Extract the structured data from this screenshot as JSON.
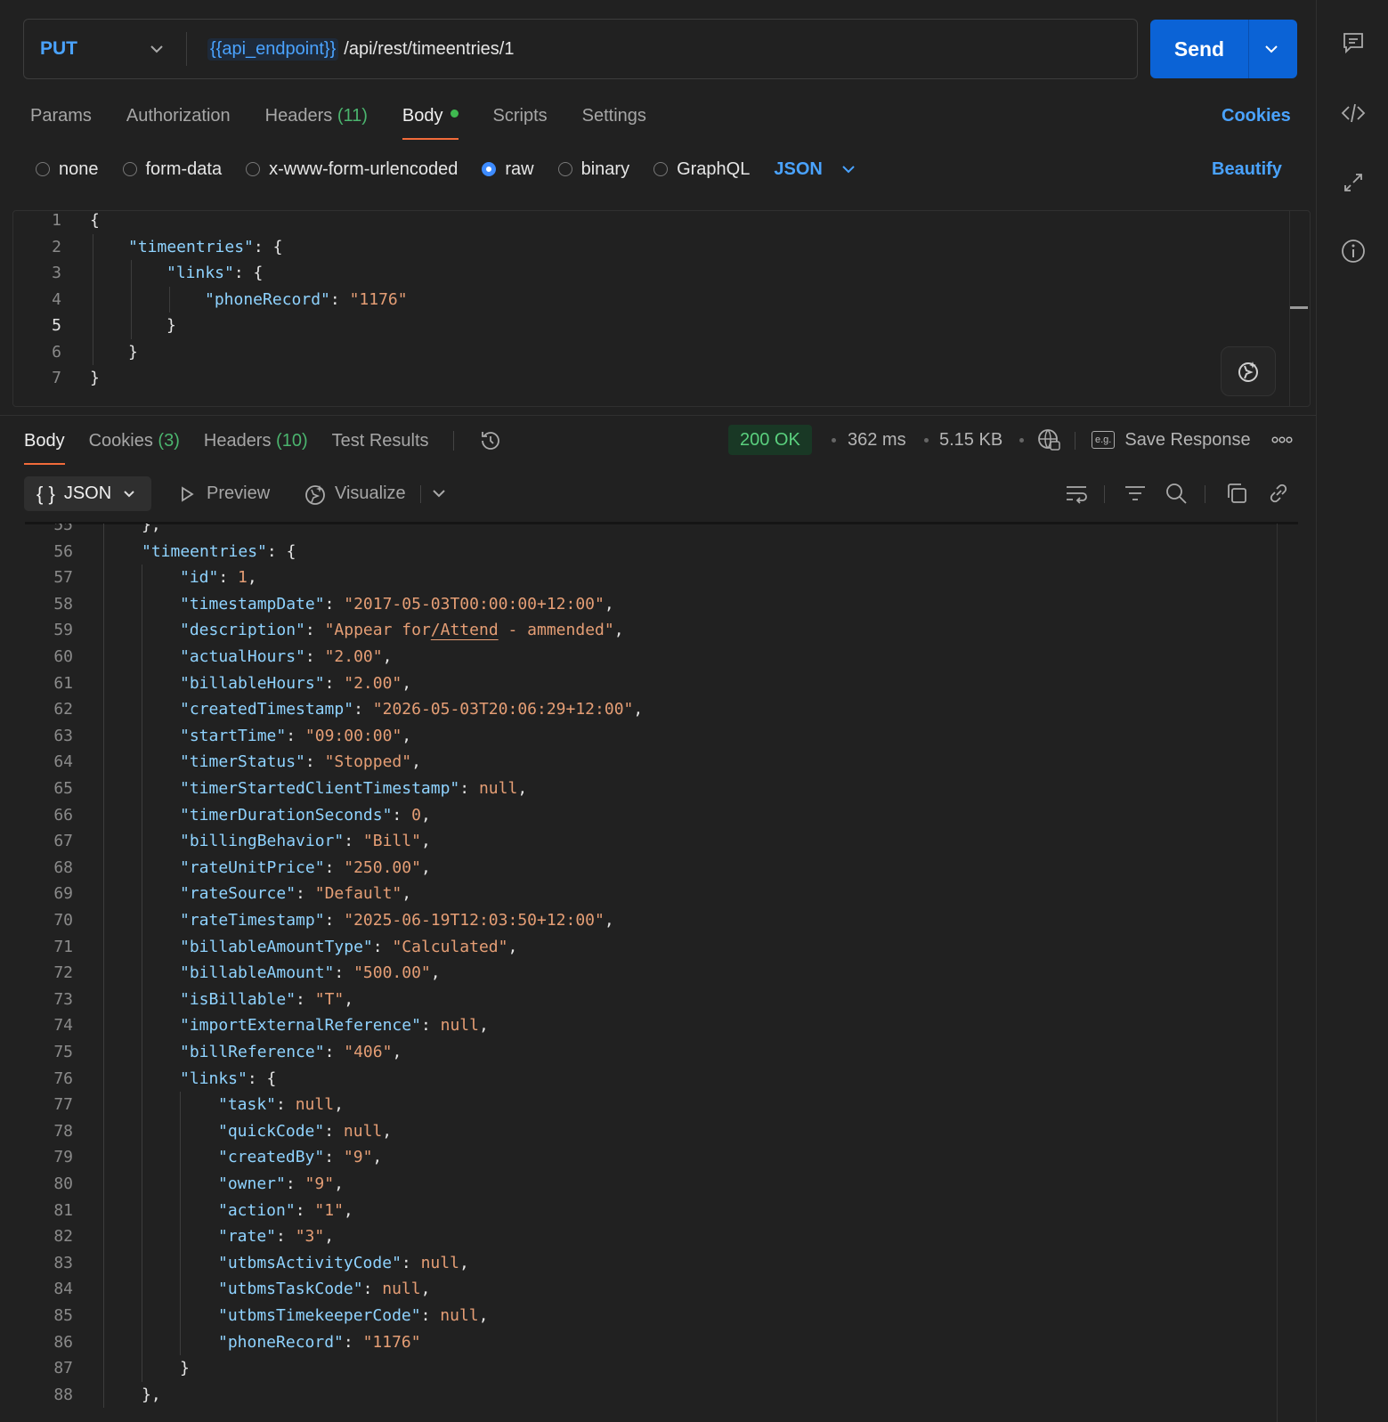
{
  "request": {
    "method": "PUT",
    "url_variable": "{{api_endpoint}}",
    "url_path": "/api/rest/timeentries/1",
    "send_label": "Send"
  },
  "request_tabs": [
    {
      "label": "Params"
    },
    {
      "label": "Authorization"
    },
    {
      "label": "Headers",
      "count": "(11)"
    },
    {
      "label": "Body",
      "active": true,
      "dot": true
    },
    {
      "label": "Scripts"
    },
    {
      "label": "Settings"
    }
  ],
  "cookies_link": "Cookies",
  "body_types": [
    {
      "label": "none",
      "selected": false
    },
    {
      "label": "form-data",
      "selected": false
    },
    {
      "label": "x-www-form-urlencoded",
      "selected": false
    },
    {
      "label": "raw",
      "selected": true
    },
    {
      "label": "binary",
      "selected": false
    },
    {
      "label": "GraphQL",
      "selected": false
    }
  ],
  "body_format": "JSON",
  "beautify_label": "Beautify",
  "request_body": [
    {
      "n": "1",
      "indent": 0,
      "tokens": [
        [
          "p",
          "{"
        ]
      ]
    },
    {
      "n": "2",
      "indent": 1,
      "tokens": [
        [
          "k",
          "\"timeentries\""
        ],
        [
          "p",
          ": {"
        ]
      ]
    },
    {
      "n": "3",
      "indent": 2,
      "tokens": [
        [
          "k",
          "\"links\""
        ],
        [
          "p",
          ": {"
        ]
      ]
    },
    {
      "n": "4",
      "indent": 3,
      "tokens": [
        [
          "k",
          "\"phoneRecord\""
        ],
        [
          "p",
          ": "
        ],
        [
          "s",
          "\"1176\""
        ]
      ]
    },
    {
      "n": "5",
      "indent": 2,
      "tokens": [
        [
          "p",
          "}"
        ]
      ],
      "current": true
    },
    {
      "n": "6",
      "indent": 1,
      "tokens": [
        [
          "p",
          "}"
        ]
      ]
    },
    {
      "n": "7",
      "indent": 0,
      "tokens": [
        [
          "p",
          "}"
        ]
      ]
    }
  ],
  "response_tabs": [
    {
      "label": "Body",
      "active": true
    },
    {
      "label": "Cookies",
      "count": "(3)"
    },
    {
      "label": "Headers",
      "count": "(10)"
    },
    {
      "label": "Test Results"
    }
  ],
  "response_meta": {
    "status": "200 OK",
    "time": "362 ms",
    "size": "5.15 KB",
    "save_label": "Save Response",
    "save_icon_text": "e.g."
  },
  "response_toolbar": {
    "format": "JSON",
    "format_icon": "{ }",
    "preview": "Preview",
    "visualize": "Visualize"
  },
  "response_body": [
    {
      "n": "55",
      "indent": 1,
      "tokens": [
        [
          "p",
          "},"
        ]
      ]
    },
    {
      "n": "56",
      "indent": 1,
      "tokens": [
        [
          "k",
          "\"timeentries\""
        ],
        [
          "p",
          ": {"
        ]
      ]
    },
    {
      "n": "57",
      "indent": 2,
      "tokens": [
        [
          "k",
          "\"id\""
        ],
        [
          "p",
          ": "
        ],
        [
          "n",
          "1"
        ],
        [
          "p",
          ","
        ]
      ]
    },
    {
      "n": "58",
      "indent": 2,
      "tokens": [
        [
          "k",
          "\"timestampDate\""
        ],
        [
          "p",
          ": "
        ],
        [
          "s",
          "\"2017-05-03T00:00:00+12:00\""
        ],
        [
          "p",
          ","
        ]
      ]
    },
    {
      "n": "59",
      "indent": 2,
      "tokens": [
        [
          "k",
          "\"description\""
        ],
        [
          "p",
          ": "
        ],
        [
          "s",
          "\"Appear for"
        ],
        [
          "su",
          "/Attend"
        ],
        [
          "s",
          " - ammended\""
        ],
        [
          "p",
          ","
        ]
      ]
    },
    {
      "n": "60",
      "indent": 2,
      "tokens": [
        [
          "k",
          "\"actualHours\""
        ],
        [
          "p",
          ": "
        ],
        [
          "s",
          "\"2.00\""
        ],
        [
          "p",
          ","
        ]
      ]
    },
    {
      "n": "61",
      "indent": 2,
      "tokens": [
        [
          "k",
          "\"billableHours\""
        ],
        [
          "p",
          ": "
        ],
        [
          "s",
          "\"2.00\""
        ],
        [
          "p",
          ","
        ]
      ]
    },
    {
      "n": "62",
      "indent": 2,
      "tokens": [
        [
          "k",
          "\"createdTimestamp\""
        ],
        [
          "p",
          ": "
        ],
        [
          "s",
          "\"2026-05-03T20:06:29+12:00\""
        ],
        [
          "p",
          ","
        ]
      ]
    },
    {
      "n": "63",
      "indent": 2,
      "tokens": [
        [
          "k",
          "\"startTime\""
        ],
        [
          "p",
          ": "
        ],
        [
          "s",
          "\"09:00:00\""
        ],
        [
          "p",
          ","
        ]
      ]
    },
    {
      "n": "64",
      "indent": 2,
      "tokens": [
        [
          "k",
          "\"timerStatus\""
        ],
        [
          "p",
          ": "
        ],
        [
          "s",
          "\"Stopped\""
        ],
        [
          "p",
          ","
        ]
      ]
    },
    {
      "n": "65",
      "indent": 2,
      "tokens": [
        [
          "k",
          "\"timerStartedClientTimestamp\""
        ],
        [
          "p",
          ": "
        ],
        [
          "n",
          "null"
        ],
        [
          "p",
          ","
        ]
      ]
    },
    {
      "n": "66",
      "indent": 2,
      "tokens": [
        [
          "k",
          "\"timerDurationSeconds\""
        ],
        [
          "p",
          ": "
        ],
        [
          "n",
          "0"
        ],
        [
          "p",
          ","
        ]
      ]
    },
    {
      "n": "67",
      "indent": 2,
      "tokens": [
        [
          "k",
          "\"billingBehavior\""
        ],
        [
          "p",
          ": "
        ],
        [
          "s",
          "\"Bill\""
        ],
        [
          "p",
          ","
        ]
      ]
    },
    {
      "n": "68",
      "indent": 2,
      "tokens": [
        [
          "k",
          "\"rateUnitPrice\""
        ],
        [
          "p",
          ": "
        ],
        [
          "s",
          "\"250.00\""
        ],
        [
          "p",
          ","
        ]
      ]
    },
    {
      "n": "69",
      "indent": 2,
      "tokens": [
        [
          "k",
          "\"rateSource\""
        ],
        [
          "p",
          ": "
        ],
        [
          "s",
          "\"Default\""
        ],
        [
          "p",
          ","
        ]
      ]
    },
    {
      "n": "70",
      "indent": 2,
      "tokens": [
        [
          "k",
          "\"rateTimestamp\""
        ],
        [
          "p",
          ": "
        ],
        [
          "s",
          "\"2025-06-19T12:03:50+12:00\""
        ],
        [
          "p",
          ","
        ]
      ]
    },
    {
      "n": "71",
      "indent": 2,
      "tokens": [
        [
          "k",
          "\"billableAmountType\""
        ],
        [
          "p",
          ": "
        ],
        [
          "s",
          "\"Calculated\""
        ],
        [
          "p",
          ","
        ]
      ]
    },
    {
      "n": "72",
      "indent": 2,
      "tokens": [
        [
          "k",
          "\"billableAmount\""
        ],
        [
          "p",
          ": "
        ],
        [
          "s",
          "\"500.00\""
        ],
        [
          "p",
          ","
        ]
      ]
    },
    {
      "n": "73",
      "indent": 2,
      "tokens": [
        [
          "k",
          "\"isBillable\""
        ],
        [
          "p",
          ": "
        ],
        [
          "s",
          "\"T\""
        ],
        [
          "p",
          ","
        ]
      ]
    },
    {
      "n": "74",
      "indent": 2,
      "tokens": [
        [
          "k",
          "\"importExternalReference\""
        ],
        [
          "p",
          ": "
        ],
        [
          "n",
          "null"
        ],
        [
          "p",
          ","
        ]
      ]
    },
    {
      "n": "75",
      "indent": 2,
      "tokens": [
        [
          "k",
          "\"billReference\""
        ],
        [
          "p",
          ": "
        ],
        [
          "s",
          "\"406\""
        ],
        [
          "p",
          ","
        ]
      ]
    },
    {
      "n": "76",
      "indent": 2,
      "tokens": [
        [
          "k",
          "\"links\""
        ],
        [
          "p",
          ": {"
        ]
      ]
    },
    {
      "n": "77",
      "indent": 3,
      "tokens": [
        [
          "k",
          "\"task\""
        ],
        [
          "p",
          ": "
        ],
        [
          "n",
          "null"
        ],
        [
          "p",
          ","
        ]
      ]
    },
    {
      "n": "78",
      "indent": 3,
      "tokens": [
        [
          "k",
          "\"quickCode\""
        ],
        [
          "p",
          ": "
        ],
        [
          "n",
          "null"
        ],
        [
          "p",
          ","
        ]
      ]
    },
    {
      "n": "79",
      "indent": 3,
      "tokens": [
        [
          "k",
          "\"createdBy\""
        ],
        [
          "p",
          ": "
        ],
        [
          "s",
          "\"9\""
        ],
        [
          "p",
          ","
        ]
      ]
    },
    {
      "n": "80",
      "indent": 3,
      "tokens": [
        [
          "k",
          "\"owner\""
        ],
        [
          "p",
          ": "
        ],
        [
          "s",
          "\"9\""
        ],
        [
          "p",
          ","
        ]
      ]
    },
    {
      "n": "81",
      "indent": 3,
      "tokens": [
        [
          "k",
          "\"action\""
        ],
        [
          "p",
          ": "
        ],
        [
          "s",
          "\"1\""
        ],
        [
          "p",
          ","
        ]
      ]
    },
    {
      "n": "82",
      "indent": 3,
      "tokens": [
        [
          "k",
          "\"rate\""
        ],
        [
          "p",
          ": "
        ],
        [
          "s",
          "\"3\""
        ],
        [
          "p",
          ","
        ]
      ]
    },
    {
      "n": "83",
      "indent": 3,
      "tokens": [
        [
          "k",
          "\"utbmsActivityCode\""
        ],
        [
          "p",
          ": "
        ],
        [
          "n",
          "null"
        ],
        [
          "p",
          ","
        ]
      ]
    },
    {
      "n": "84",
      "indent": 3,
      "tokens": [
        [
          "k",
          "\"utbmsTaskCode\""
        ],
        [
          "p",
          ": "
        ],
        [
          "n",
          "null"
        ],
        [
          "p",
          ","
        ]
      ]
    },
    {
      "n": "85",
      "indent": 3,
      "tokens": [
        [
          "k",
          "\"utbmsTimekeeperCode\""
        ],
        [
          "p",
          ": "
        ],
        [
          "n",
          "null"
        ],
        [
          "p",
          ","
        ]
      ]
    },
    {
      "n": "86",
      "indent": 3,
      "tokens": [
        [
          "k",
          "\"phoneRecord\""
        ],
        [
          "p",
          ": "
        ],
        [
          "s",
          "\"1176\""
        ]
      ]
    },
    {
      "n": "87",
      "indent": 2,
      "tokens": [
        [
          "p",
          "}"
        ]
      ]
    },
    {
      "n": "88",
      "indent": 1,
      "tokens": [
        [
          "p",
          "},"
        ]
      ]
    }
  ],
  "colors": {
    "accent": "#0b63d6",
    "link": "#4aa3ff",
    "key": "#8fd3ff",
    "string": "#e59e75",
    "status_ok": "#5ad07e",
    "active_tab": "#f26b3a"
  }
}
